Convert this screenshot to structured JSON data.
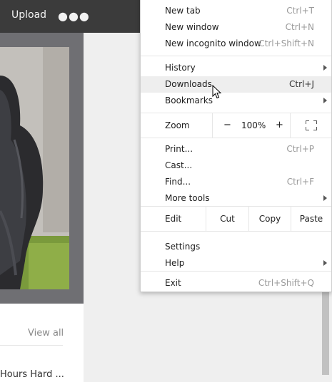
{
  "page": {
    "header": {
      "upload_label": "Upload",
      "more_icon": "ellipsis-icon"
    },
    "view_all_label": "View all",
    "headline_text": "Hours Hard ..."
  },
  "menu": {
    "items_top": [
      {
        "label": "New tab",
        "shortcut": "Ctrl+T"
      },
      {
        "label": "New window",
        "shortcut": "Ctrl+N"
      },
      {
        "label": "New incognito window",
        "shortcut": "Ctrl+Shift+N"
      }
    ],
    "history": {
      "label": "History"
    },
    "downloads": {
      "label": "Downloads",
      "shortcut": "Ctrl+J"
    },
    "bookmarks": {
      "label": "Bookmarks"
    },
    "zoom": {
      "label": "Zoom",
      "minus": "−",
      "value": "100%",
      "plus": "+"
    },
    "items_mid": [
      {
        "label": "Print...",
        "shortcut": "Ctrl+P"
      },
      {
        "label": "Cast...",
        "shortcut": ""
      },
      {
        "label": "Find...",
        "shortcut": "Ctrl+F"
      }
    ],
    "more_tools": {
      "label": "More tools"
    },
    "edit": {
      "label": "Edit",
      "cut": "Cut",
      "copy": "Copy",
      "paste": "Paste"
    },
    "settings": {
      "label": "Settings"
    },
    "help": {
      "label": "Help"
    },
    "exit": {
      "label": "Exit",
      "shortcut": "Ctrl+Shift+Q"
    },
    "highlighted_item": "Downloads"
  }
}
